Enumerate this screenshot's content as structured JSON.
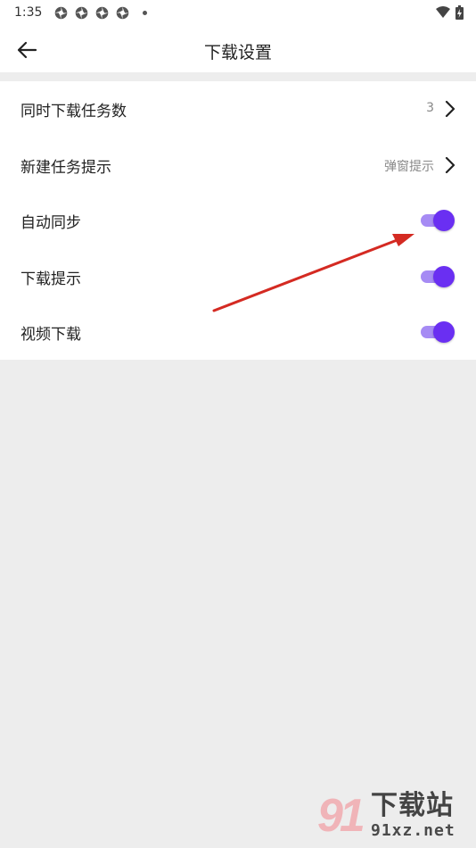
{
  "status_bar": {
    "time": "1:35",
    "notification_icons": [
      "app-notification-icon",
      "app-notification-icon",
      "app-notification-icon",
      "app-notification-icon"
    ],
    "system_icons": [
      "wifi-icon",
      "battery-charging-icon"
    ]
  },
  "header": {
    "title": "下载设置",
    "back_icon": "arrow-left-icon"
  },
  "settings": {
    "concurrent_downloads": {
      "label": "同时下载任务数",
      "value": "3"
    },
    "new_task_prompt": {
      "label": "新建任务提示",
      "value": "弹窗提示"
    },
    "auto_sync": {
      "label": "自动同步",
      "enabled": true
    },
    "download_prompt": {
      "label": "下载提示",
      "enabled": true
    },
    "video_download": {
      "label": "视频下载",
      "enabled": true
    }
  },
  "colors": {
    "toggle_thumb": "#6a2ff2",
    "toggle_track": "#a68bf4",
    "background": "#ededed",
    "annotation_arrow": "#d42a22"
  },
  "watermark": {
    "logo_text": "91",
    "title": "下载站",
    "url": "91xz.net"
  }
}
